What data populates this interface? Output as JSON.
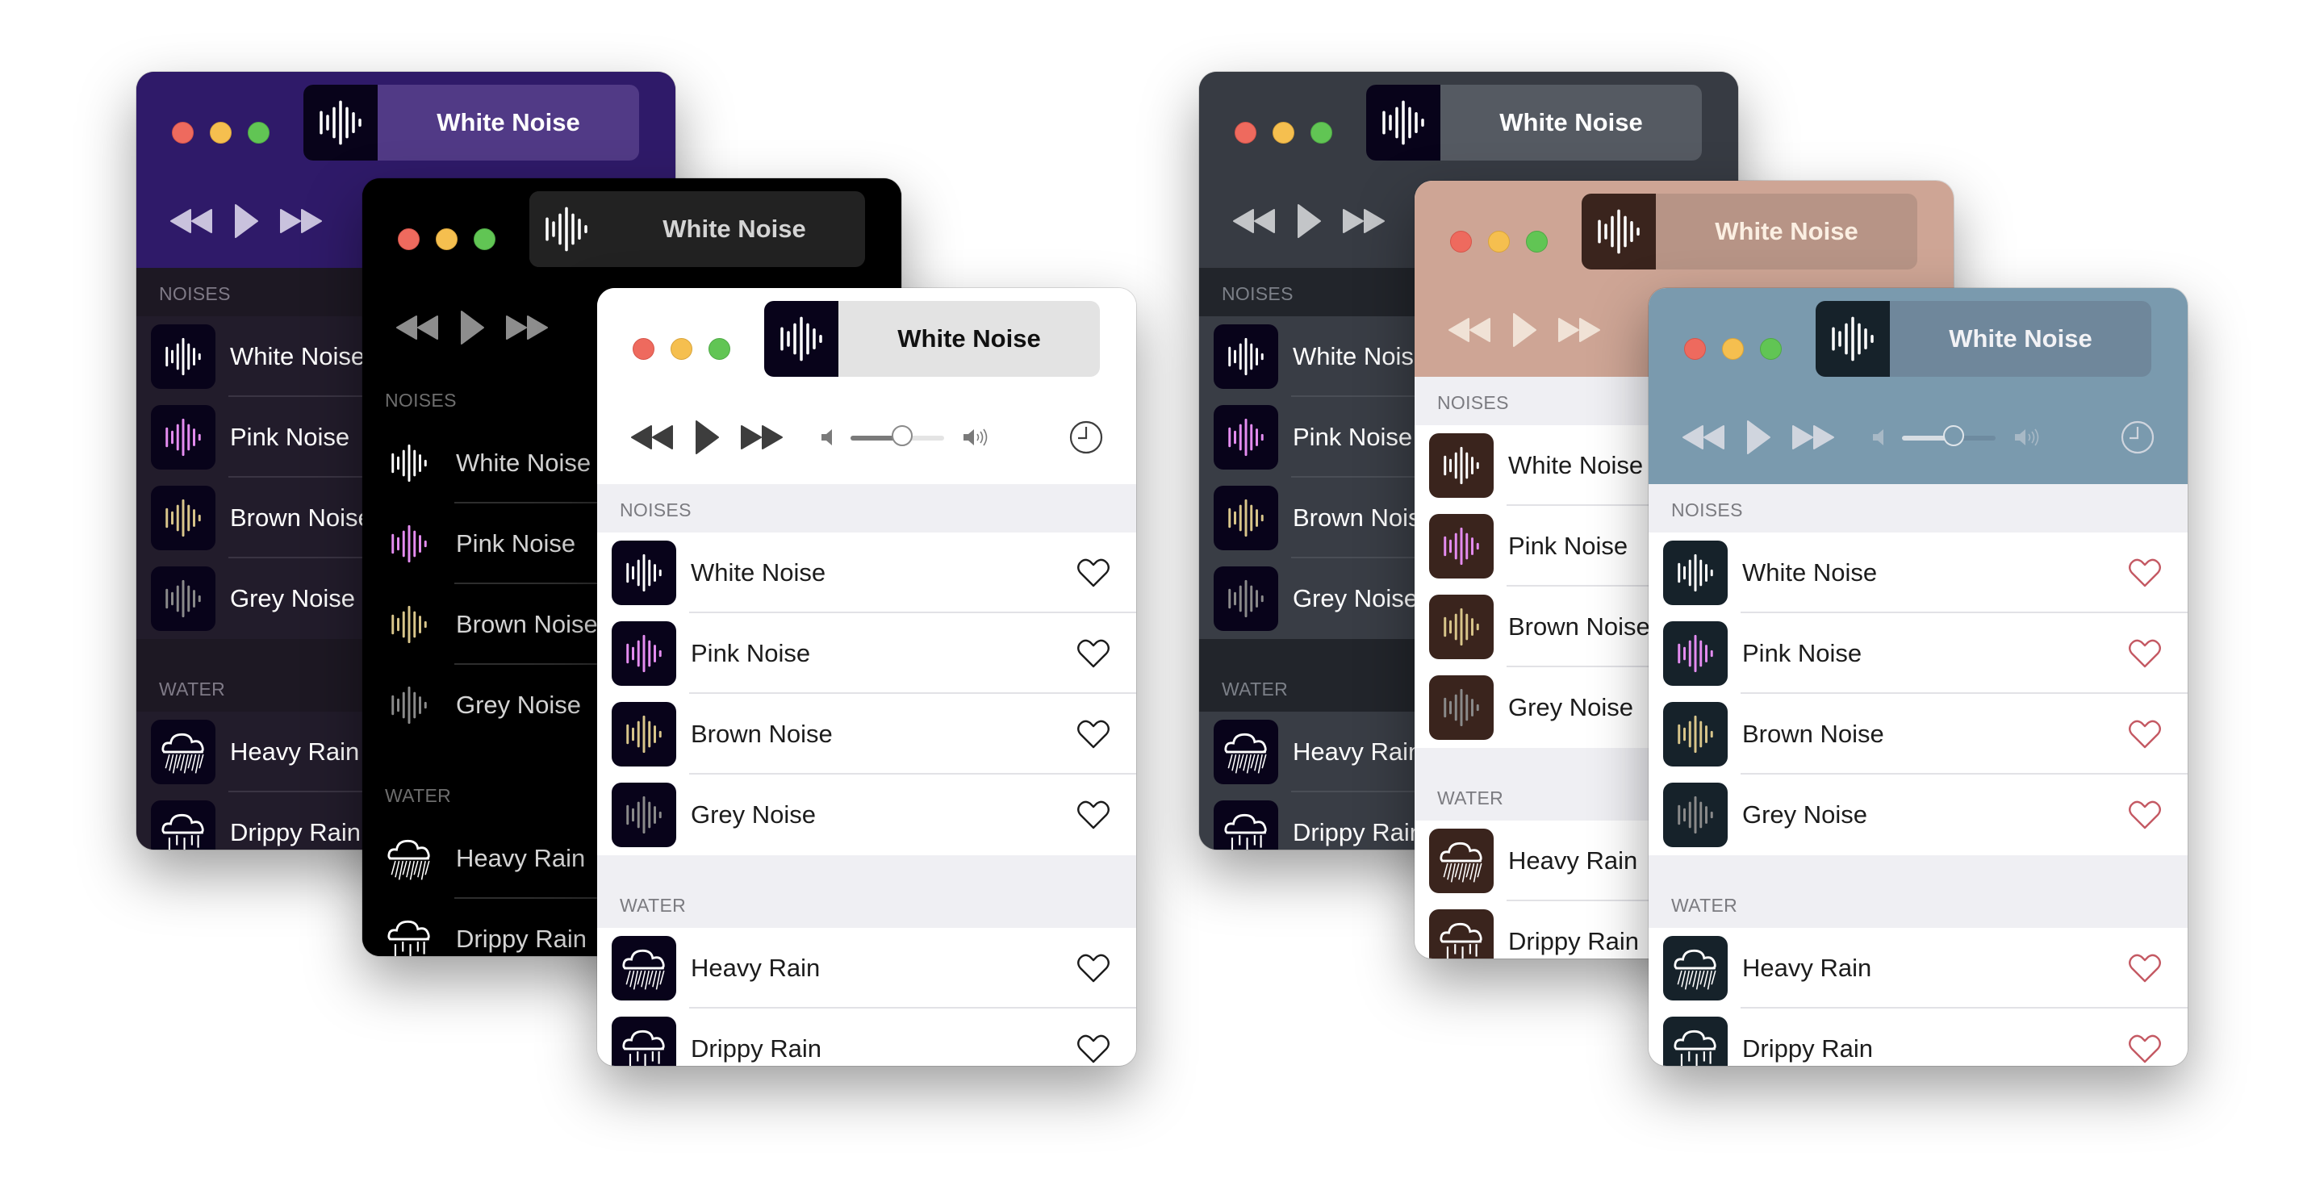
{
  "app": {
    "now_playing_title": "White Noise",
    "volume_level": 0.55,
    "sections": [
      {
        "label": "NOISES",
        "items": [
          {
            "name": "White Noise",
            "icon": "waveform-icon",
            "icon_color": "#ffffff"
          },
          {
            "name": "Pink Noise",
            "icon": "waveform-icon",
            "icon_color": "#e48cf0"
          },
          {
            "name": "Brown Noise",
            "icon": "waveform-icon",
            "icon_color": "#d8c58a"
          },
          {
            "name": "Grey Noise",
            "icon": "waveform-icon",
            "icon_color": "#8a8a8a"
          }
        ]
      },
      {
        "label": "WATER",
        "items": [
          {
            "name": "Heavy Rain",
            "icon": "heavy-rain-icon",
            "icon_color": "#ffffff"
          },
          {
            "name": "Drippy Rain",
            "icon": "drippy-rain-icon",
            "icon_color": "#ffffff"
          }
        ]
      }
    ]
  },
  "windows": [
    {
      "theme": "purple",
      "title": "White Noise",
      "show_volume": false,
      "show_hearts": false,
      "colors": {
        "header": "#2f1a69",
        "pill": "#513a86",
        "pill_art": "#08031a",
        "title_text": "#ffffff",
        "controls": "#c9c2dd",
        "list_bg": "#221c2b",
        "section_bg": "#1d1823",
        "section_text": "#7f7a87",
        "row_text": "#ffffff",
        "sep": "#3a3443",
        "icon_bg": "#08031a",
        "heart": "#ffffff"
      }
    },
    {
      "theme": "black",
      "title": "White Noise",
      "show_volume": false,
      "show_hearts": false,
      "colors": {
        "header": "#000000",
        "pill": "#222222",
        "pill_art": "#222222",
        "title_text": "#d4d4d4",
        "controls": "#8d8d8d",
        "list_bg": "#000000",
        "section_bg": "#000000",
        "section_text": "#6e6e6e",
        "row_text": "#d4d4d4",
        "sep": "#2d2d2d",
        "icon_bg": "#000000",
        "heart": "#ffffff"
      }
    },
    {
      "theme": "light",
      "title": "White Noise",
      "show_volume": true,
      "show_hearts": true,
      "colors": {
        "header": "#ffffff",
        "pill": "#e3e3e3",
        "pill_art": "#08031a",
        "title_text": "#111111",
        "controls": "#3d3d3d",
        "list_bg": "#ffffff",
        "section_bg": "#efeff3",
        "section_text": "#7b7b80",
        "row_text": "#1c1c1c",
        "sep": "#e2e2e6",
        "icon_bg": "#08031a",
        "heart": "#1c1c1c",
        "slider_fill": "#7a7a7a",
        "slider_track": "#e4e4e4",
        "vol_icon": "#7a7a7a"
      }
    },
    {
      "theme": "graphite",
      "title": "White Noise",
      "show_volume": false,
      "show_hearts": false,
      "colors": {
        "header": "#373b43",
        "pill": "#555a62",
        "pill_art": "#08031a",
        "title_text": "#ffffff",
        "controls": "#c3c5c8",
        "list_bg": "#393d45",
        "section_bg": "#22252b",
        "section_text": "#7c8088",
        "row_text": "#ffffff",
        "sep": "#4a4e56",
        "icon_bg": "#08031a",
        "heart": "#ffffff"
      }
    },
    {
      "theme": "rose",
      "title": "White Noise",
      "show_volume": false,
      "show_hearts": false,
      "colors": {
        "header": "#cea595",
        "pill": "#b79486",
        "pill_art": "#3a241d",
        "title_text": "#fbefe2",
        "controls": "#f0e2d6",
        "list_bg": "#ffffff",
        "section_bg": "#efeff3",
        "section_text": "#7b7b80",
        "row_text": "#1c1c1c",
        "sep": "#e2e2e6",
        "icon_bg": "#3a241d",
        "heart": "#1c1c1c"
      }
    },
    {
      "theme": "blue",
      "title": "White Noise",
      "show_volume": true,
      "show_hearts": true,
      "colors": {
        "header": "#7a9aae",
        "pill": "#6f879b",
        "pill_art": "#16222a",
        "title_text": "#f2f2f5",
        "controls": "#d0d5de",
        "list_bg": "#ffffff",
        "section_bg": "#efeff3",
        "section_text": "#7b7b80",
        "row_text": "#1c1c1c",
        "sep": "#e2e2e6",
        "icon_bg": "#16222a",
        "heart": "#c45963",
        "slider_fill": "#d7dde3",
        "slider_track": "#6e8ba0",
        "vol_icon": "#a8b9c6"
      }
    }
  ]
}
